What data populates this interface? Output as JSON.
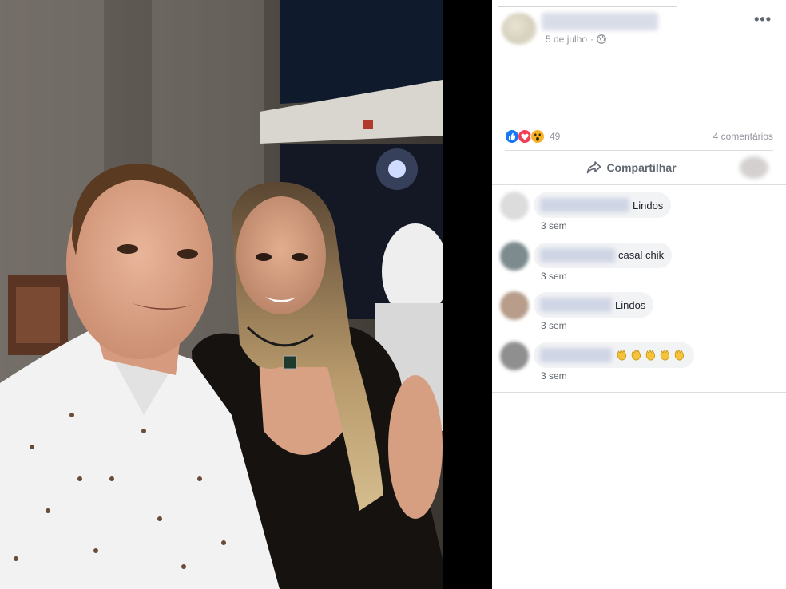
{
  "post": {
    "date": "5 de julho",
    "date_separator": "·",
    "more_glyph": "•••",
    "privacy_icon": "globe-icon"
  },
  "reactions": {
    "icons": [
      "like-icon",
      "love-icon",
      "wow-icon"
    ],
    "count": "49",
    "comments_count": "4 comentários",
    "like_color": "#1877f2",
    "love_color": "#f33e58",
    "wow_color": "#f7b125"
  },
  "actions": {
    "share_label": "Compartilhar"
  },
  "comments": [
    {
      "text": "Lindos",
      "time": "3 sem"
    },
    {
      "text": "casal chik",
      "time": "3 sem"
    },
    {
      "text": "Lindos",
      "time": "3 sem"
    },
    {
      "text": "",
      "emoji": [
        "clap-icon",
        "clap-icon",
        "clap-icon",
        "clap-icon",
        "clap-icon"
      ],
      "time": "3 sem"
    }
  ]
}
